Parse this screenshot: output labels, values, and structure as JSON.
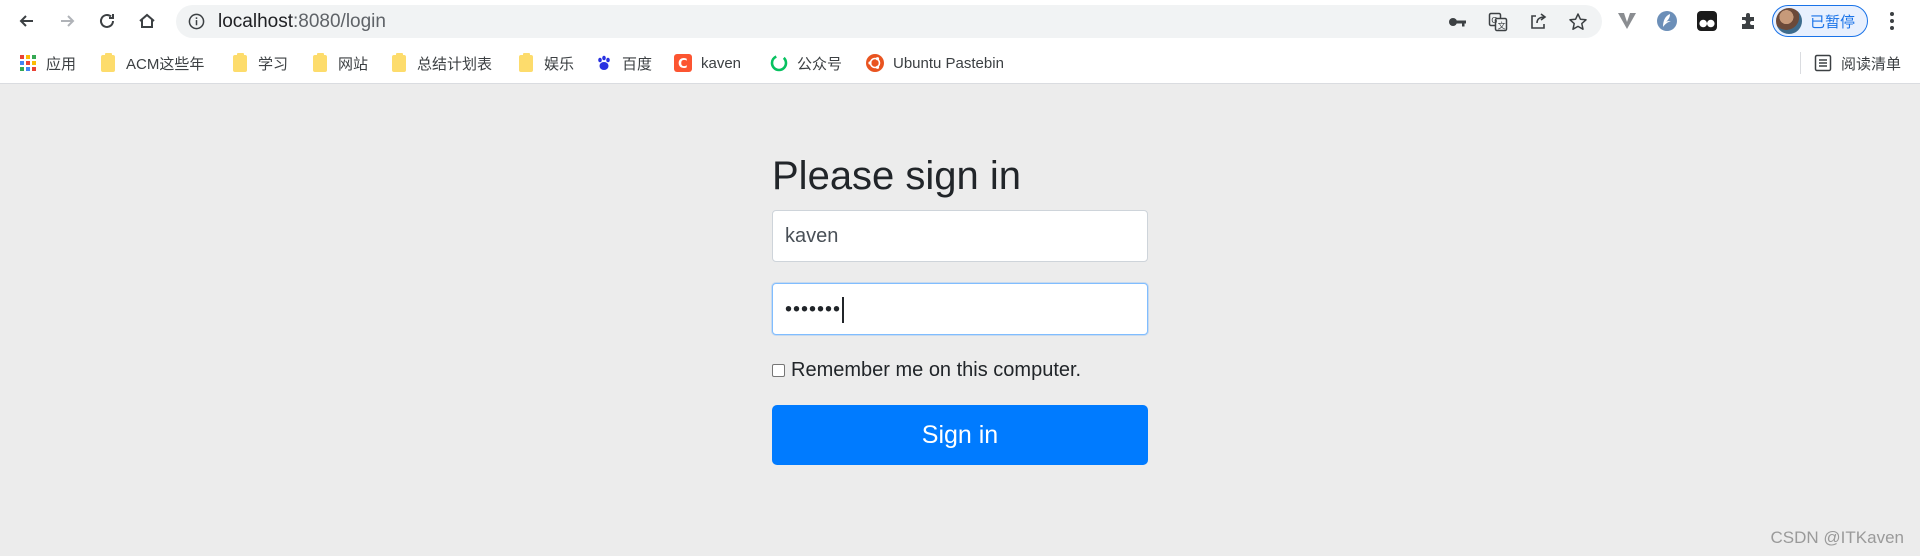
{
  "browser": {
    "url_host": "localhost",
    "url_rest": ":8080/login",
    "profile_label": "已暂停",
    "icons": {
      "back": "arrow-left-icon",
      "forward": "arrow-right-icon",
      "reload": "reload-icon",
      "home": "home-icon",
      "site_info": "info-icon",
      "password": "key-icon",
      "translate": "translate-icon",
      "share": "share-icon",
      "bookmark_star": "star-icon",
      "extensions": "puzzle-icon",
      "menu": "kebab-menu-icon"
    }
  },
  "bookmarks": [
    {
      "label": "应用",
      "icon": "apps-grid-icon"
    },
    {
      "label": "ACM这些年",
      "icon": "folder-icon"
    },
    {
      "label": "学习",
      "icon": "folder-icon"
    },
    {
      "label": "网站",
      "icon": "folder-icon"
    },
    {
      "label": "总结计划表",
      "icon": "folder-icon"
    },
    {
      "label": "娱乐",
      "icon": "folder-icon"
    },
    {
      "label": "百度",
      "icon": "baidu-paw-icon"
    },
    {
      "label": "kaven",
      "icon": "csdn-icon"
    },
    {
      "label": "公众号",
      "icon": "wechat-icon"
    },
    {
      "label": "Ubuntu Pastebin",
      "icon": "ubuntu-icon"
    }
  ],
  "reading_list_label": "阅读清单",
  "login": {
    "title": "Please sign in",
    "username_value": "kaven",
    "password_masked": "•••••••",
    "remember_label": "Remember me on this computer.",
    "remember_checked": false,
    "submit_label": "Sign in"
  },
  "watermark": "CSDN @ITKaven",
  "colors": {
    "page_bg": "#ececec",
    "primary": "#007bff",
    "focus_border": "#80bdff"
  }
}
